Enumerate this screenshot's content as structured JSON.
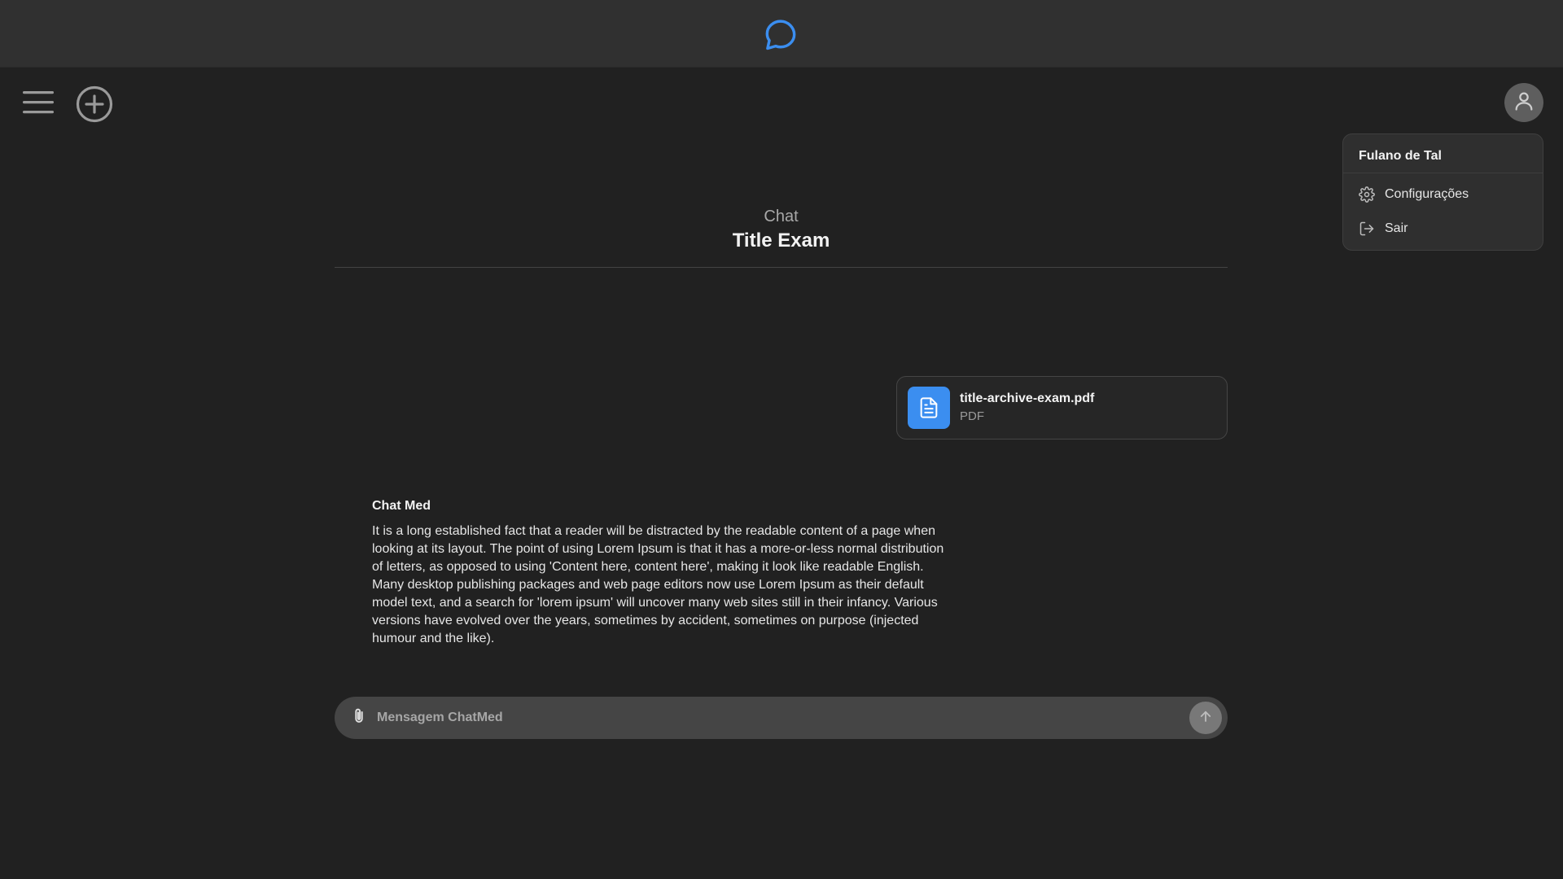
{
  "topbar": {
    "logo_icon": "chat-bubble-icon",
    "accent_color": "#3b8ef0"
  },
  "toolbar": {
    "menu_icon": "hamburger-icon",
    "new_chat_icon": "plus-circle-icon",
    "avatar_icon": "user-icon"
  },
  "user_menu": {
    "user_name": "Fulano de Tal",
    "items": [
      {
        "label": "Configurações",
        "icon": "gear-icon"
      },
      {
        "label": "Sair",
        "icon": "logout-icon"
      }
    ]
  },
  "chat": {
    "kicker": "Chat",
    "title": "Title Exam"
  },
  "attachment": {
    "file_name": "title-archive-exam.pdf",
    "file_type": "PDF",
    "icon": "document-icon",
    "icon_color": "#3b8ef0"
  },
  "message": {
    "sender": "Chat Med",
    "text": "It is a long established fact that a reader will be distracted by the readable content of a page when looking at its layout. The point of using Lorem Ipsum is that it has a more-or-less normal distribution of letters, as opposed to using 'Content here, content here', making it look like readable English. Many desktop publishing packages and web page editors now use Lorem Ipsum as their default model text, and a search for 'lorem ipsum' will uncover many web sites still in their infancy. Various versions have evolved over the years, sometimes by accident, sometimes on purpose (injected humour and the like)."
  },
  "composer": {
    "placeholder": "Mensagem ChatMed",
    "value": "",
    "attach_icon": "paperclip-icon",
    "send_icon": "arrow-up-icon"
  }
}
